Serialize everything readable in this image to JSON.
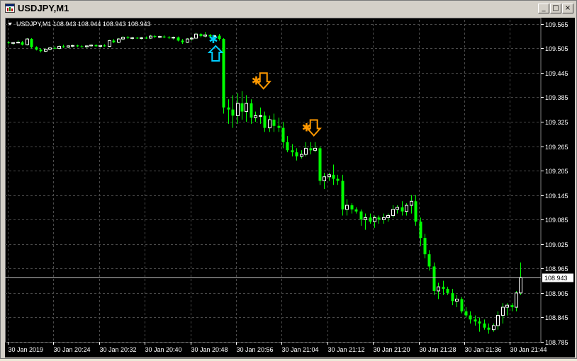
{
  "window": {
    "title": "USDJPY,M1",
    "controls": [
      "_",
      "□",
      "×"
    ]
  },
  "chart_header": {
    "text": "USDJPY,M1  108.943 108.944 108.943 108.943"
  },
  "colors": {
    "background": "#000000",
    "grid": "#4a4a4a",
    "axis_text": "#ffffff",
    "bull": "#ffffff",
    "bear": "#00ff00",
    "buy_arrow": "#00ccff",
    "sell_arrow": "#ff9900"
  },
  "chart_data": {
    "type": "candlestick",
    "symbol": "USDJPY",
    "timeframe": "M1",
    "price_labels": [
      "109.565",
      "109.505",
      "109.445",
      "109.385",
      "109.325",
      "109.265",
      "109.205",
      "109.145",
      "109.085",
      "109.025",
      "108.965",
      "108.905",
      "108.845",
      "108.785"
    ],
    "ylim": [
      108.785,
      109.575
    ],
    "time_labels": [
      "30 Jan 2019",
      "30 Jan 20:24",
      "30 Jan 20:32",
      "30 Jan 20:40",
      "30 Jan 20:48",
      "30 Jan 20:56",
      "30 Jan 21:04",
      "30 Jan 21:12",
      "30 Jan 21:20",
      "30 Jan 21:28",
      "30 Jan 21:36",
      "30 Jan 21:44"
    ],
    "current_price": "108.943",
    "grid": true,
    "candles": [
      [
        109.52,
        109.522,
        109.515,
        109.518
      ],
      [
        109.518,
        109.52,
        109.514,
        109.519
      ],
      [
        109.519,
        109.524,
        109.517,
        109.52
      ],
      [
        109.52,
        109.523,
        109.512,
        109.514
      ],
      [
        109.514,
        109.53,
        109.512,
        109.528
      ],
      [
        109.528,
        109.53,
        109.505,
        109.508
      ],
      [
        109.508,
        109.51,
        109.5,
        109.502
      ],
      [
        109.502,
        109.505,
        109.495,
        109.498
      ],
      [
        109.498,
        109.505,
        109.496,
        109.503
      ],
      [
        109.503,
        109.508,
        109.5,
        109.506
      ],
      [
        109.506,
        109.51,
        109.503,
        109.505
      ],
      [
        109.505,
        109.512,
        109.503,
        109.51
      ],
      [
        109.51,
        109.514,
        109.506,
        109.508
      ],
      [
        109.508,
        109.512,
        109.506,
        109.511
      ],
      [
        109.511,
        109.514,
        109.508,
        109.512
      ],
      [
        109.512,
        109.514,
        109.508,
        109.51
      ],
      [
        109.51,
        109.513,
        109.507,
        109.509
      ],
      [
        109.509,
        109.512,
        109.506,
        109.511
      ],
      [
        109.511,
        109.515,
        109.509,
        109.513
      ],
      [
        109.513,
        109.515,
        109.509,
        109.51
      ],
      [
        109.51,
        109.513,
        109.507,
        109.512
      ],
      [
        109.512,
        109.515,
        109.509,
        109.51
      ],
      [
        109.51,
        109.526,
        109.508,
        109.524
      ],
      [
        109.524,
        109.528,
        109.518,
        109.52
      ],
      [
        109.52,
        109.53,
        109.518,
        109.528
      ],
      [
        109.528,
        109.535,
        109.525,
        109.532
      ],
      [
        109.532,
        109.535,
        109.528,
        109.53
      ],
      [
        109.53,
        109.533,
        109.527,
        109.531
      ],
      [
        109.531,
        109.533,
        109.528,
        109.53
      ],
      [
        109.53,
        109.533,
        109.527,
        109.531
      ],
      [
        109.531,
        109.534,
        109.528,
        109.53
      ],
      [
        109.53,
        109.538,
        109.528,
        109.535
      ],
      [
        109.535,
        109.538,
        109.53,
        109.533
      ],
      [
        109.533,
        109.536,
        109.53,
        109.534
      ],
      [
        109.534,
        109.537,
        109.53,
        109.532
      ],
      [
        109.532,
        109.535,
        109.528,
        109.531
      ],
      [
        109.531,
        109.534,
        109.527,
        109.532
      ],
      [
        109.532,
        109.534,
        109.522,
        109.524
      ],
      [
        109.524,
        109.528,
        109.516,
        109.52
      ],
      [
        109.52,
        109.53,
        109.518,
        109.528
      ],
      [
        109.528,
        109.533,
        109.524,
        109.53
      ],
      [
        109.53,
        109.543,
        109.528,
        109.54
      ],
      [
        109.54,
        109.542,
        109.532,
        109.535
      ],
      [
        109.535,
        109.545,
        109.532,
        109.538
      ],
      [
        109.538,
        109.54,
        109.532,
        109.534
      ],
      [
        109.534,
        109.538,
        109.53,
        109.536
      ],
      [
        109.536,
        109.54,
        109.524,
        109.528
      ],
      [
        109.528,
        109.53,
        109.345,
        109.36
      ],
      [
        109.36,
        109.38,
        109.32,
        109.355
      ],
      [
        109.355,
        109.39,
        109.31,
        109.34
      ],
      [
        109.34,
        109.395,
        109.32,
        109.37
      ],
      [
        109.37,
        109.4,
        109.33,
        109.35
      ],
      [
        109.35,
        109.39,
        109.325,
        109.37
      ],
      [
        109.37,
        109.38,
        109.32,
        109.335
      ],
      [
        109.335,
        109.35,
        109.325,
        109.34
      ],
      [
        109.34,
        109.36,
        109.32,
        109.34
      ],
      [
        109.34,
        109.35,
        109.3,
        109.31
      ],
      [
        109.31,
        109.34,
        109.3,
        109.33
      ],
      [
        109.33,
        109.345,
        109.3,
        109.315
      ],
      [
        109.315,
        109.335,
        109.3,
        109.31
      ],
      [
        109.31,
        109.325,
        109.26,
        109.275
      ],
      [
        109.275,
        109.29,
        109.25,
        109.255
      ],
      [
        109.255,
        109.27,
        109.24,
        109.25
      ],
      [
        109.25,
        109.26,
        109.23,
        109.24
      ],
      [
        109.24,
        109.255,
        109.235,
        109.245
      ],
      [
        109.245,
        109.275,
        109.24,
        109.26
      ],
      [
        109.26,
        109.275,
        109.245,
        109.255
      ],
      [
        109.255,
        109.275,
        109.25,
        109.26
      ],
      [
        109.26,
        109.265,
        109.17,
        109.18
      ],
      [
        109.18,
        109.2,
        109.16,
        109.19
      ],
      [
        109.19,
        109.2,
        109.18,
        109.195
      ],
      [
        109.195,
        109.22,
        109.17,
        109.185
      ],
      [
        109.185,
        109.195,
        109.17,
        109.18
      ],
      [
        109.18,
        109.195,
        109.095,
        109.11
      ],
      [
        109.11,
        109.135,
        109.095,
        109.12
      ],
      [
        109.12,
        109.125,
        109.1,
        109.11
      ],
      [
        109.11,
        109.115,
        109.1,
        109.105
      ],
      [
        109.105,
        109.11,
        109.07,
        109.085
      ],
      [
        109.085,
        109.1,
        109.06,
        109.09
      ],
      [
        109.09,
        109.1,
        109.075,
        109.08
      ],
      [
        109.08,
        109.095,
        109.065,
        109.09
      ],
      [
        109.09,
        109.095,
        109.075,
        109.085
      ],
      [
        109.085,
        109.1,
        109.075,
        109.09
      ],
      [
        109.09,
        109.1,
        109.08,
        109.095
      ],
      [
        109.095,
        109.12,
        109.09,
        109.11
      ],
      [
        109.11,
        109.12,
        109.1,
        109.115
      ],
      [
        109.115,
        109.13,
        109.095,
        109.105
      ],
      [
        109.105,
        109.125,
        109.095,
        109.12
      ],
      [
        109.12,
        109.145,
        109.1,
        109.13
      ],
      [
        109.13,
        109.145,
        109.07,
        109.08
      ],
      [
        109.08,
        109.09,
        109.02,
        109.04
      ],
      [
        109.04,
        109.05,
        108.99,
        109.0
      ],
      [
        109.0,
        109.01,
        108.96,
        108.97
      ],
      [
        108.97,
        108.98,
        108.9,
        108.91
      ],
      [
        108.91,
        108.93,
        108.89,
        108.92
      ],
      [
        108.92,
        108.935,
        108.9,
        108.915
      ],
      [
        108.915,
        108.92,
        108.9,
        108.905
      ],
      [
        108.905,
        108.915,
        108.875,
        108.885
      ],
      [
        108.885,
        108.9,
        108.87,
        108.89
      ],
      [
        108.89,
        108.895,
        108.855,
        108.86
      ],
      [
        108.86,
        108.87,
        108.845,
        108.85
      ],
      [
        108.85,
        108.86,
        108.83,
        108.84
      ],
      [
        108.84,
        108.85,
        108.825,
        108.835
      ],
      [
        108.835,
        108.845,
        108.81,
        108.83
      ],
      [
        108.83,
        108.84,
        108.815,
        108.82
      ],
      [
        108.82,
        108.83,
        108.805,
        108.815
      ],
      [
        108.815,
        108.83,
        108.81,
        108.825
      ],
      [
        108.825,
        108.86,
        108.815,
        108.85
      ],
      [
        108.85,
        108.88,
        108.83,
        108.87
      ],
      [
        108.87,
        108.88,
        108.85,
        108.875
      ],
      [
        108.875,
        108.88,
        108.86,
        108.87
      ],
      [
        108.87,
        108.91,
        108.86,
        108.905
      ],
      [
        108.905,
        108.98,
        108.9,
        108.943
      ]
    ],
    "signals": [
      {
        "type": "buy",
        "candle": 45,
        "price": 109.49
      },
      {
        "type": "sell",
        "candle": 55,
        "price": 109.42
      },
      {
        "type": "sell",
        "candle": 66,
        "price": 109.305
      }
    ]
  }
}
